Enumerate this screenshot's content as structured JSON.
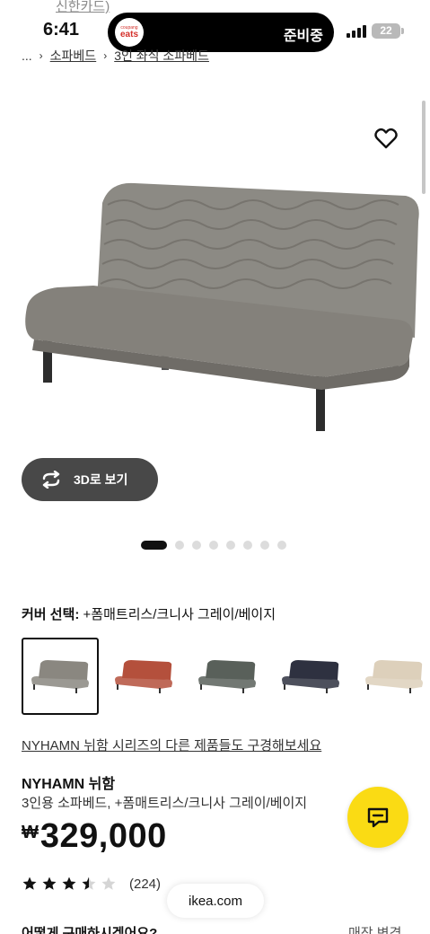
{
  "peek": {
    "text": "신한카드)"
  },
  "status_bar": {
    "time": "6:41",
    "island_logo_small": "coupang",
    "island_logo_big": "eats",
    "island_status": "준비중",
    "battery": "22"
  },
  "breadcrumb": {
    "ellipsis": "...",
    "items": [
      "소파베드",
      "3인 좌식 소파베드"
    ]
  },
  "product_image": {
    "alt": "NYHAMN 뉘함 3인용 소파베드 그레이/베이지"
  },
  "view3d": {
    "label": "3D로 보기"
  },
  "carousel": {
    "total": 8,
    "active": 1
  },
  "cover": {
    "label": "커버 선택:",
    "value": "+폼매트리스/크니사 그레이/베이지"
  },
  "swatches": [
    {
      "color": "#8a8780",
      "name": "grey-beige",
      "selected": true
    },
    {
      "color": "#b4503c",
      "name": "red",
      "selected": false
    },
    {
      "color": "#59605a",
      "name": "dark-grey-green",
      "selected": false
    },
    {
      "color": "#2e3140",
      "name": "dark-blue",
      "selected": false
    },
    {
      "color": "#ddd0bb",
      "name": "beige",
      "selected": false
    }
  ],
  "series_link": "NYHAMN 뉘함 시리즈의 다른 제품들도 구경해보세요",
  "product": {
    "name": "NYHAMN 뉘함",
    "description": "3인용 소파베드, +폼매트리스/크니사 그레이/베이지",
    "currency": "₩",
    "price": "329,000"
  },
  "rating": {
    "stars": 3.5,
    "max": 5,
    "count": "(224)"
  },
  "url_bar": {
    "text": "ikea.com"
  },
  "bottom": {
    "left": "어떻게 구매하시겠어요?",
    "right": "매장 변경"
  },
  "colors": {
    "accent_yellow": "#fadb14",
    "button_dark": "#484848"
  }
}
